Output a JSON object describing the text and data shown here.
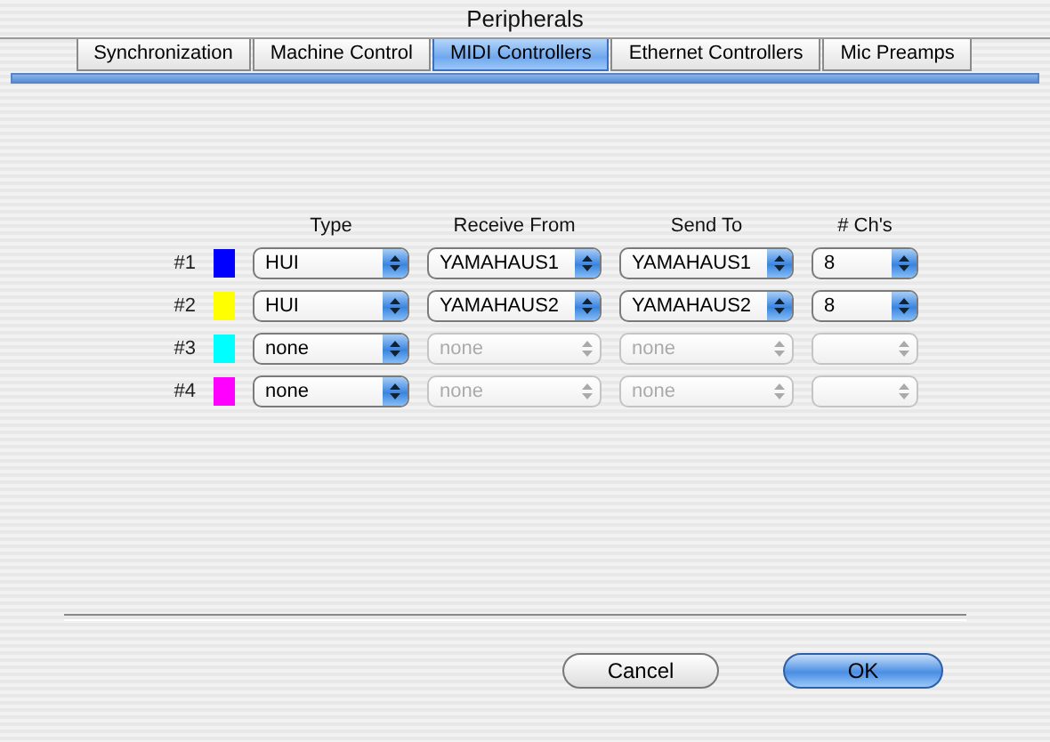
{
  "window": {
    "title": "Peripherals"
  },
  "tabs": [
    {
      "label": "Synchronization",
      "selected": false
    },
    {
      "label": "Machine Control",
      "selected": false
    },
    {
      "label": "MIDI Controllers",
      "selected": true
    },
    {
      "label": "Ethernet Controllers",
      "selected": false
    },
    {
      "label": "Mic Preamps",
      "selected": false
    }
  ],
  "columns": [
    "Type",
    "Receive From",
    "Send To",
    "# Ch's"
  ],
  "rows": [
    {
      "label": "#1",
      "color": "#0000ff",
      "cells": [
        {
          "value": "HUI",
          "disabled": false
        },
        {
          "value": "YAMAHAUS1",
          "disabled": false
        },
        {
          "value": "YAMAHAUS1",
          "disabled": false
        },
        {
          "value": "8",
          "disabled": false
        }
      ]
    },
    {
      "label": "#2",
      "color": "#ffff00",
      "cells": [
        {
          "value": "HUI",
          "disabled": false
        },
        {
          "value": "YAMAHAUS2",
          "disabled": false
        },
        {
          "value": "YAMAHAUS2",
          "disabled": false
        },
        {
          "value": "8",
          "disabled": false
        }
      ]
    },
    {
      "label": "#3",
      "color": "#00ffff",
      "cells": [
        {
          "value": "none",
          "disabled": false
        },
        {
          "value": "none",
          "disabled": true
        },
        {
          "value": "none",
          "disabled": true
        },
        {
          "disabled": true
        }
      ]
    },
    {
      "label": "#4",
      "color": "#ff00ff",
      "cells": [
        {
          "value": "none",
          "disabled": false
        },
        {
          "value": "none",
          "disabled": true
        },
        {
          "value": "none",
          "disabled": true
        },
        {
          "disabled": true
        }
      ]
    }
  ],
  "buttons": [
    {
      "label": "Cancel",
      "default": false
    },
    {
      "label": "OK",
      "default": true
    }
  ]
}
